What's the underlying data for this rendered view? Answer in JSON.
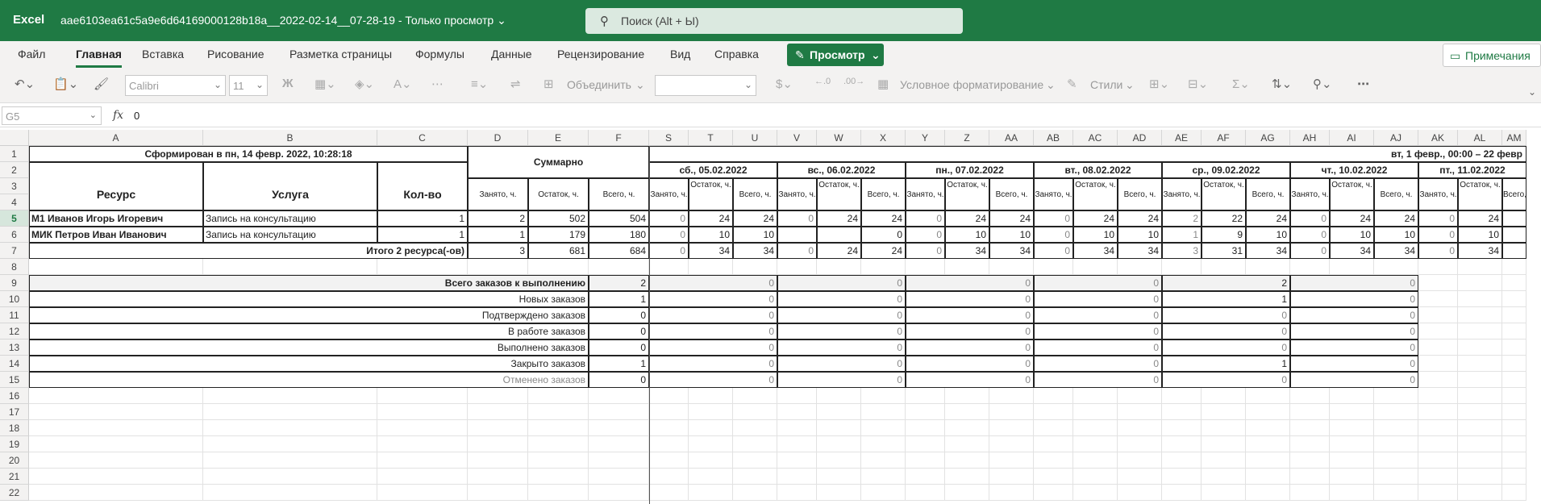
{
  "title_bar": {
    "app": "Excel",
    "doc": "aae6103ea61c5a9e6d64169000128b18a__2022-02-14__07-28-19 - Только просмотр",
    "search": "Поиск (Alt + Ы)"
  },
  "tabs": [
    "Файл",
    "Главная",
    "Вставка",
    "Рисование",
    "Разметка страницы",
    "Формулы",
    "Данные",
    "Рецензирование",
    "Вид",
    "Справка"
  ],
  "view_button": "Просмотр",
  "notes_button": "Примечания",
  "toolbar": {
    "font": "Calibri",
    "size": "11",
    "bold": "Ж",
    "merge": "Объединить",
    "cond_format": "Условное форматирование",
    "styles": "Стили"
  },
  "formula_bar": {
    "namebox": "G5",
    "fx": "fx",
    "value": "0"
  },
  "columns": [
    "A",
    "B",
    "C",
    "D",
    "E",
    "F",
    "S",
    "T",
    "U",
    "V",
    "W",
    "X",
    "Y",
    "Z",
    "AA",
    "AB",
    "AC",
    "AD",
    "AE",
    "AF",
    "AG",
    "AH",
    "AI",
    "AJ",
    "AK",
    "AL",
    "AM"
  ],
  "rows": [
    "1",
    "2",
    "3",
    "4",
    "5",
    "6",
    "7",
    "8",
    "9",
    "10",
    "11",
    "12",
    "13",
    "14",
    "15",
    "16",
    "17",
    "18",
    "19",
    "20",
    "21",
    "22"
  ],
  "sheet": {
    "generated": "Сформирован в пн, 14 февр. 2022, 10:28:18",
    "resource": "Ресурс",
    "service": "Услуга",
    "qty": "Кол-во",
    "summary": "Суммарно",
    "period": "вт, 1 февр., 00:00 – 22 февр",
    "sub_headers": [
      "Занято, ч.",
      "Остаток, ч.",
      "Всего, ч."
    ],
    "days": [
      "сб., 05.02.2022",
      "вс., 06.02.2022",
      "пн., 07.02.2022",
      "вт., 08.02.2022",
      "ср., 09.02.2022",
      "чт., 10.02.2022",
      "пт., 11.02.2022"
    ],
    "resources": [
      {
        "name": "M1 Иванов Игорь Игоревич",
        "service": "Запись на консультацию",
        "qty": "1",
        "sum": [
          "2",
          "502",
          "504"
        ],
        "days": [
          [
            "0",
            "24",
            "24"
          ],
          [
            "0",
            "24",
            "24"
          ],
          [
            "0",
            "24",
            "24"
          ],
          [
            "0",
            "24",
            "24"
          ],
          [
            "2",
            "22",
            "24"
          ],
          [
            "0",
            "24",
            "24"
          ],
          [
            "0",
            "24",
            ""
          ]
        ]
      },
      {
        "name": "МИК Петров Иван Иванович",
        "service": "Запись на консультацию",
        "qty": "1",
        "sum": [
          "1",
          "179",
          "180"
        ],
        "days": [
          [
            "0",
            "10",
            "10"
          ],
          [
            "",
            "",
            "0"
          ],
          [
            "0",
            "10",
            "10"
          ],
          [
            "0",
            "10",
            "10"
          ],
          [
            "1",
            "9",
            "10"
          ],
          [
            "0",
            "10",
            "10"
          ],
          [
            "0",
            "10",
            ""
          ]
        ]
      }
    ],
    "total_label": "Итого 2 ресурса(-ов)",
    "total_sum": [
      "3",
      "681",
      "684"
    ],
    "total_days": [
      [
        "0",
        "34",
        "34"
      ],
      [
        "0",
        "24",
        "24"
      ],
      [
        "0",
        "34",
        "34"
      ],
      [
        "0",
        "34",
        "34"
      ],
      [
        "3",
        "31",
        "34"
      ],
      [
        "0",
        "34",
        "34"
      ],
      [
        "0",
        "34",
        ""
      ]
    ],
    "orders": [
      {
        "label": "Всего заказов к выполнению",
        "sum": "2",
        "days": [
          "0",
          "0",
          "0",
          "0",
          "2",
          "0"
        ]
      },
      {
        "label": "Новых заказов",
        "sum": "1",
        "days": [
          "0",
          "0",
          "0",
          "0",
          "1",
          "0"
        ]
      },
      {
        "label": "Подтверждено заказов",
        "sum": "0",
        "days": [
          "0",
          "0",
          "0",
          "0",
          "0",
          "0"
        ]
      },
      {
        "label": "В работе заказов",
        "sum": "0",
        "days": [
          "0",
          "0",
          "0",
          "0",
          "0",
          "0"
        ]
      },
      {
        "label": "Выполнено заказов",
        "sum": "0",
        "days": [
          "0",
          "0",
          "0",
          "0",
          "0",
          "0"
        ]
      },
      {
        "label": "Закрыто заказов",
        "sum": "1",
        "days": [
          "0",
          "0",
          "0",
          "0",
          "1",
          "0"
        ]
      },
      {
        "label": "Отменено заказов",
        "sum": "0",
        "days": [
          "0",
          "0",
          "0",
          "0",
          "0",
          "0"
        ]
      }
    ]
  }
}
